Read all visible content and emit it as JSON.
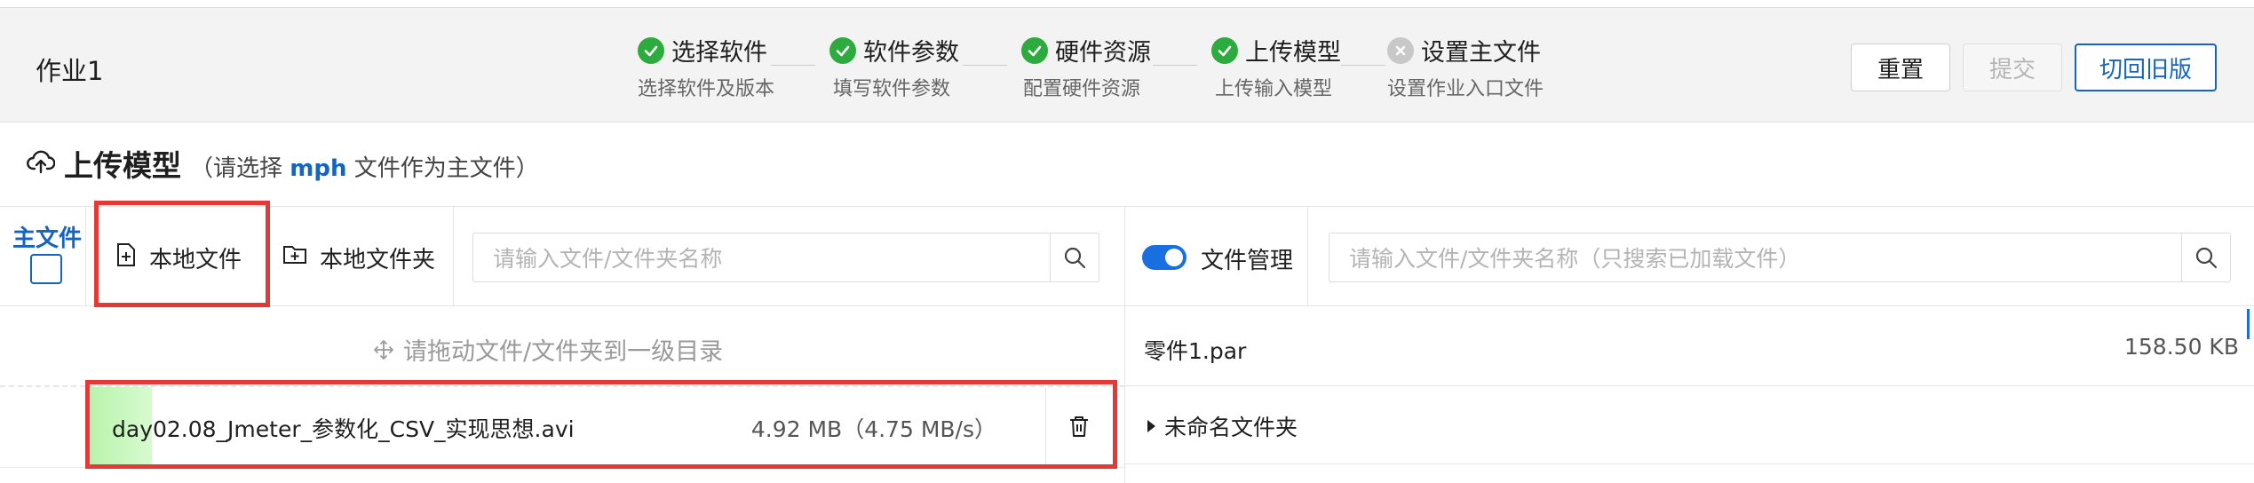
{
  "header": {
    "job_title": "作业1",
    "steps": [
      {
        "title": "选择软件",
        "desc": "选择软件及版本",
        "status": "done"
      },
      {
        "title": "软件参数",
        "desc": "填写软件参数",
        "status": "done"
      },
      {
        "title": "硬件资源",
        "desc": "配置硬件资源",
        "status": "done"
      },
      {
        "title": "上传模型",
        "desc": "上传输入模型",
        "status": "done"
      },
      {
        "title": "设置主文件",
        "desc": "设置作业入口文件",
        "status": "pending"
      }
    ],
    "buttons": {
      "reset": "重置",
      "submit": "提交",
      "old_version": "切回旧版"
    }
  },
  "section": {
    "title": "上传模型",
    "hint_prefix": "（请选择",
    "hint_ext": "mph",
    "hint_suffix": "文件作为主文件）"
  },
  "toolbar": {
    "main_file_label": "主文件",
    "local_file": "本地文件",
    "local_folder": "本地文件夹",
    "left_search_placeholder": "请输入文件/文件夹名称",
    "file_manage_label": "文件管理",
    "file_manage_on": true,
    "right_search_placeholder": "请输入文件/文件夹名称（只搜索已加载文件）"
  },
  "left_panel": {
    "drop_hint": "请拖动文件/文件夹到一级目录",
    "uploads": [
      {
        "name": "day02.08_Jmeter_参数化_CSV_实现思想.avi",
        "size": "4.92 MB（4.75 MB/s）",
        "progress": 0.06
      }
    ]
  },
  "right_panel": {
    "files": [
      {
        "name": "零件1.par",
        "size": "158.50 KB"
      }
    ],
    "folders": [
      {
        "name": "未命名文件夹"
      }
    ]
  },
  "colors": {
    "accent": "#1565c0",
    "success": "#2dab3e",
    "highlight_frame": "#e53935",
    "progress": "#b9f3ad"
  },
  "icons": [
    "check-circle-icon",
    "close-circle-icon",
    "cloud-upload-icon",
    "file-add-icon",
    "folder-add-icon",
    "search-icon",
    "move-icon",
    "trash-icon",
    "caret-right-icon"
  ]
}
